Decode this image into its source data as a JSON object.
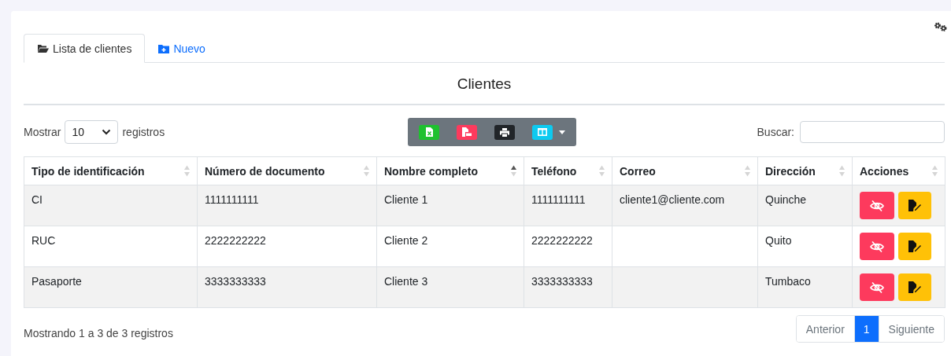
{
  "tabs": [
    {
      "label": "Lista de clientes",
      "selected": true
    },
    {
      "label": "Nuevo",
      "selected": false
    }
  ],
  "title": "Clientes",
  "length_control": {
    "prefix": "Mostrar",
    "value": "10",
    "suffix": "registros"
  },
  "export_buttons": [
    {
      "kind": "excel"
    },
    {
      "kind": "pdf"
    },
    {
      "kind": "print"
    },
    {
      "kind": "columns"
    }
  ],
  "search": {
    "label": "Buscar:"
  },
  "table": {
    "columns": [
      {
        "label": "Tipo de identificación",
        "sorted_ascending": false
      },
      {
        "label": "Número de documento",
        "sorted_ascending": false
      },
      {
        "label": "Nombre completo",
        "sorted_ascending": true
      },
      {
        "label": "Teléfono",
        "sorted_ascending": false
      },
      {
        "label": "Correo",
        "sorted_ascending": false
      },
      {
        "label": "Dirección",
        "sorted_ascending": false
      },
      {
        "label": "Acciones",
        "sorted_ascending": false
      }
    ],
    "rows": [
      {
        "cells": [
          "CI",
          "1111111111",
          "Cliente 1",
          "1111111111",
          "cliente1@cliente.com",
          "Quinche"
        ]
      },
      {
        "cells": [
          "RUC",
          "2222222222",
          "Cliente 2",
          "2222222222",
          "",
          "Quito"
        ]
      },
      {
        "cells": [
          "Pasaporte",
          "3333333333",
          "Cliente 3",
          "3333333333",
          "",
          "Tumbaco"
        ]
      }
    ]
  },
  "info": "Mostrando 1 a 3 de 3 registros",
  "pagination": [
    {
      "label": "Anterior",
      "selected": false,
      "disabled": true
    },
    {
      "label": "1",
      "selected": true,
      "disabled": false
    },
    {
      "label": "Siguiente",
      "selected": false,
      "disabled": true
    }
  ]
}
